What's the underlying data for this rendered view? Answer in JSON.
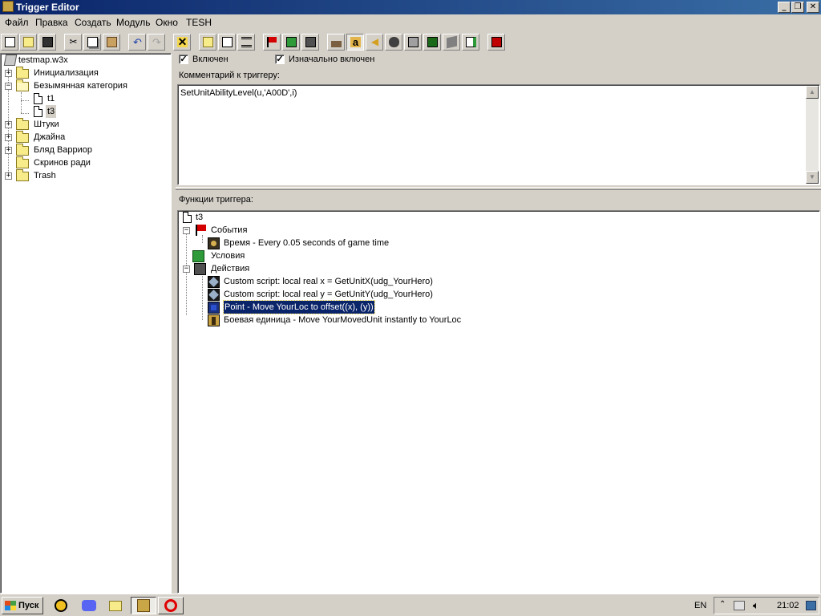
{
  "window": {
    "title": "Trigger Editor",
    "minimize_glyph": "_",
    "maximize_glyph": "❐",
    "close_glyph": "✕"
  },
  "menu": [
    "Файл",
    "Правка",
    "Создать",
    "Модуль",
    "Окно",
    "TESH"
  ],
  "toolbar_icons": [
    "new-icon",
    "open-icon",
    "save-icon",
    "cut-icon",
    "copy-icon",
    "paste-icon",
    "undo-icon",
    "redo-icon",
    "delete-icon",
    "new-category-icon",
    "new-trigger-icon",
    "new-comment-icon",
    "new-event-icon",
    "new-condition-icon",
    "new-action-icon",
    "terrain-editor-icon",
    "object-editor-icon",
    "sound-editor-icon",
    "ai-editor-icon",
    "import-manager-icon",
    "custom-script-icon",
    "sound-icon",
    "test-map-icon",
    "validate-icon"
  ],
  "tree": {
    "root": "testmap.w3x",
    "items": [
      {
        "label": "Инициализация",
        "type": "folder",
        "expand": "+"
      },
      {
        "label": "Безымянная категория",
        "type": "folder-open",
        "expand": "−"
      },
      {
        "label": "t1",
        "type": "trigger"
      },
      {
        "label": "t3",
        "type": "trigger"
      },
      {
        "label": "Штуки",
        "type": "folder",
        "expand": "+"
      },
      {
        "label": "Джайна",
        "type": "folder",
        "expand": "+"
      },
      {
        "label": "Бляд Варриор",
        "type": "folder",
        "expand": "+"
      },
      {
        "label": "Скринов ради",
        "type": "folder"
      },
      {
        "label": "Trash",
        "type": "folder",
        "expand": "+"
      }
    ]
  },
  "trigger": {
    "enabled_label": "Включен",
    "initially_on_label": "Изначально включен",
    "check": "✓",
    "comment_label": "Комментарий к триггеру:",
    "comment_text": "SetUnitAbilityLevel(u,'A00D',i)",
    "functions_label": "Функции триггера:",
    "name": "t3",
    "events_label": "События",
    "event_1": "Время - Every 0.05 seconds of game time",
    "conditions_label": "Условия",
    "actions_label": "Действия",
    "action_1": "Custom script:   local real x = GetUnitX(udg_YourHero)",
    "action_2": "Custom script:   local real y = GetUnitY(udg_YourHero)",
    "action_3": "Point - Move YourLoc to offset((x), (y))",
    "action_4": "Боевая единица - Move YourMovedUnit instantly to YourLoc",
    "expand_minus": "−"
  },
  "taskbar": {
    "start_label": "Пуск",
    "language": "EN",
    "time": "21:02"
  },
  "colors": {
    "titlebar": "#0a246a",
    "selection": "#0a246a",
    "folder": "#f8ec8a",
    "event_flag": "#d40000"
  }
}
